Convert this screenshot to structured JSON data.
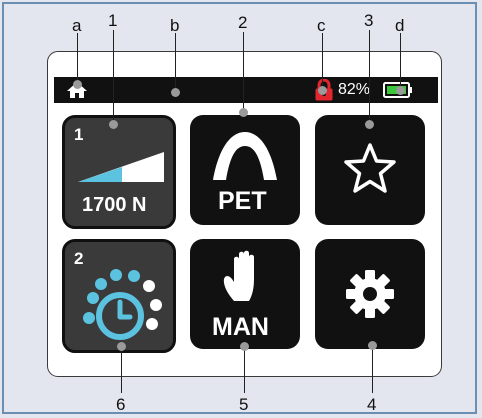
{
  "status_bar": {
    "battery_percent": "82%"
  },
  "callouts": {
    "a": "a",
    "b": "b",
    "c": "c",
    "d": "d",
    "n1": "1",
    "n2": "2",
    "n3": "3",
    "n4": "4",
    "n5": "5",
    "n6": "6"
  },
  "tiles": {
    "force": {
      "slot": "1",
      "value": "1700 N"
    },
    "pet": {
      "label": "PET"
    },
    "favorites": {
      "label": ""
    },
    "timer": {
      "slot": "2"
    },
    "manual": {
      "label": "MAN"
    },
    "settings": {
      "label": ""
    }
  },
  "colors": {
    "accent": "#5bc3e0",
    "lock": "#e0262f",
    "battery": "#3cc83c",
    "frame": "#6b8fb3"
  },
  "icons": [
    "home-icon",
    "lock-icon",
    "battery-icon",
    "arch-icon",
    "star-icon",
    "clock-icon",
    "hand-icon",
    "gear-icon"
  ]
}
